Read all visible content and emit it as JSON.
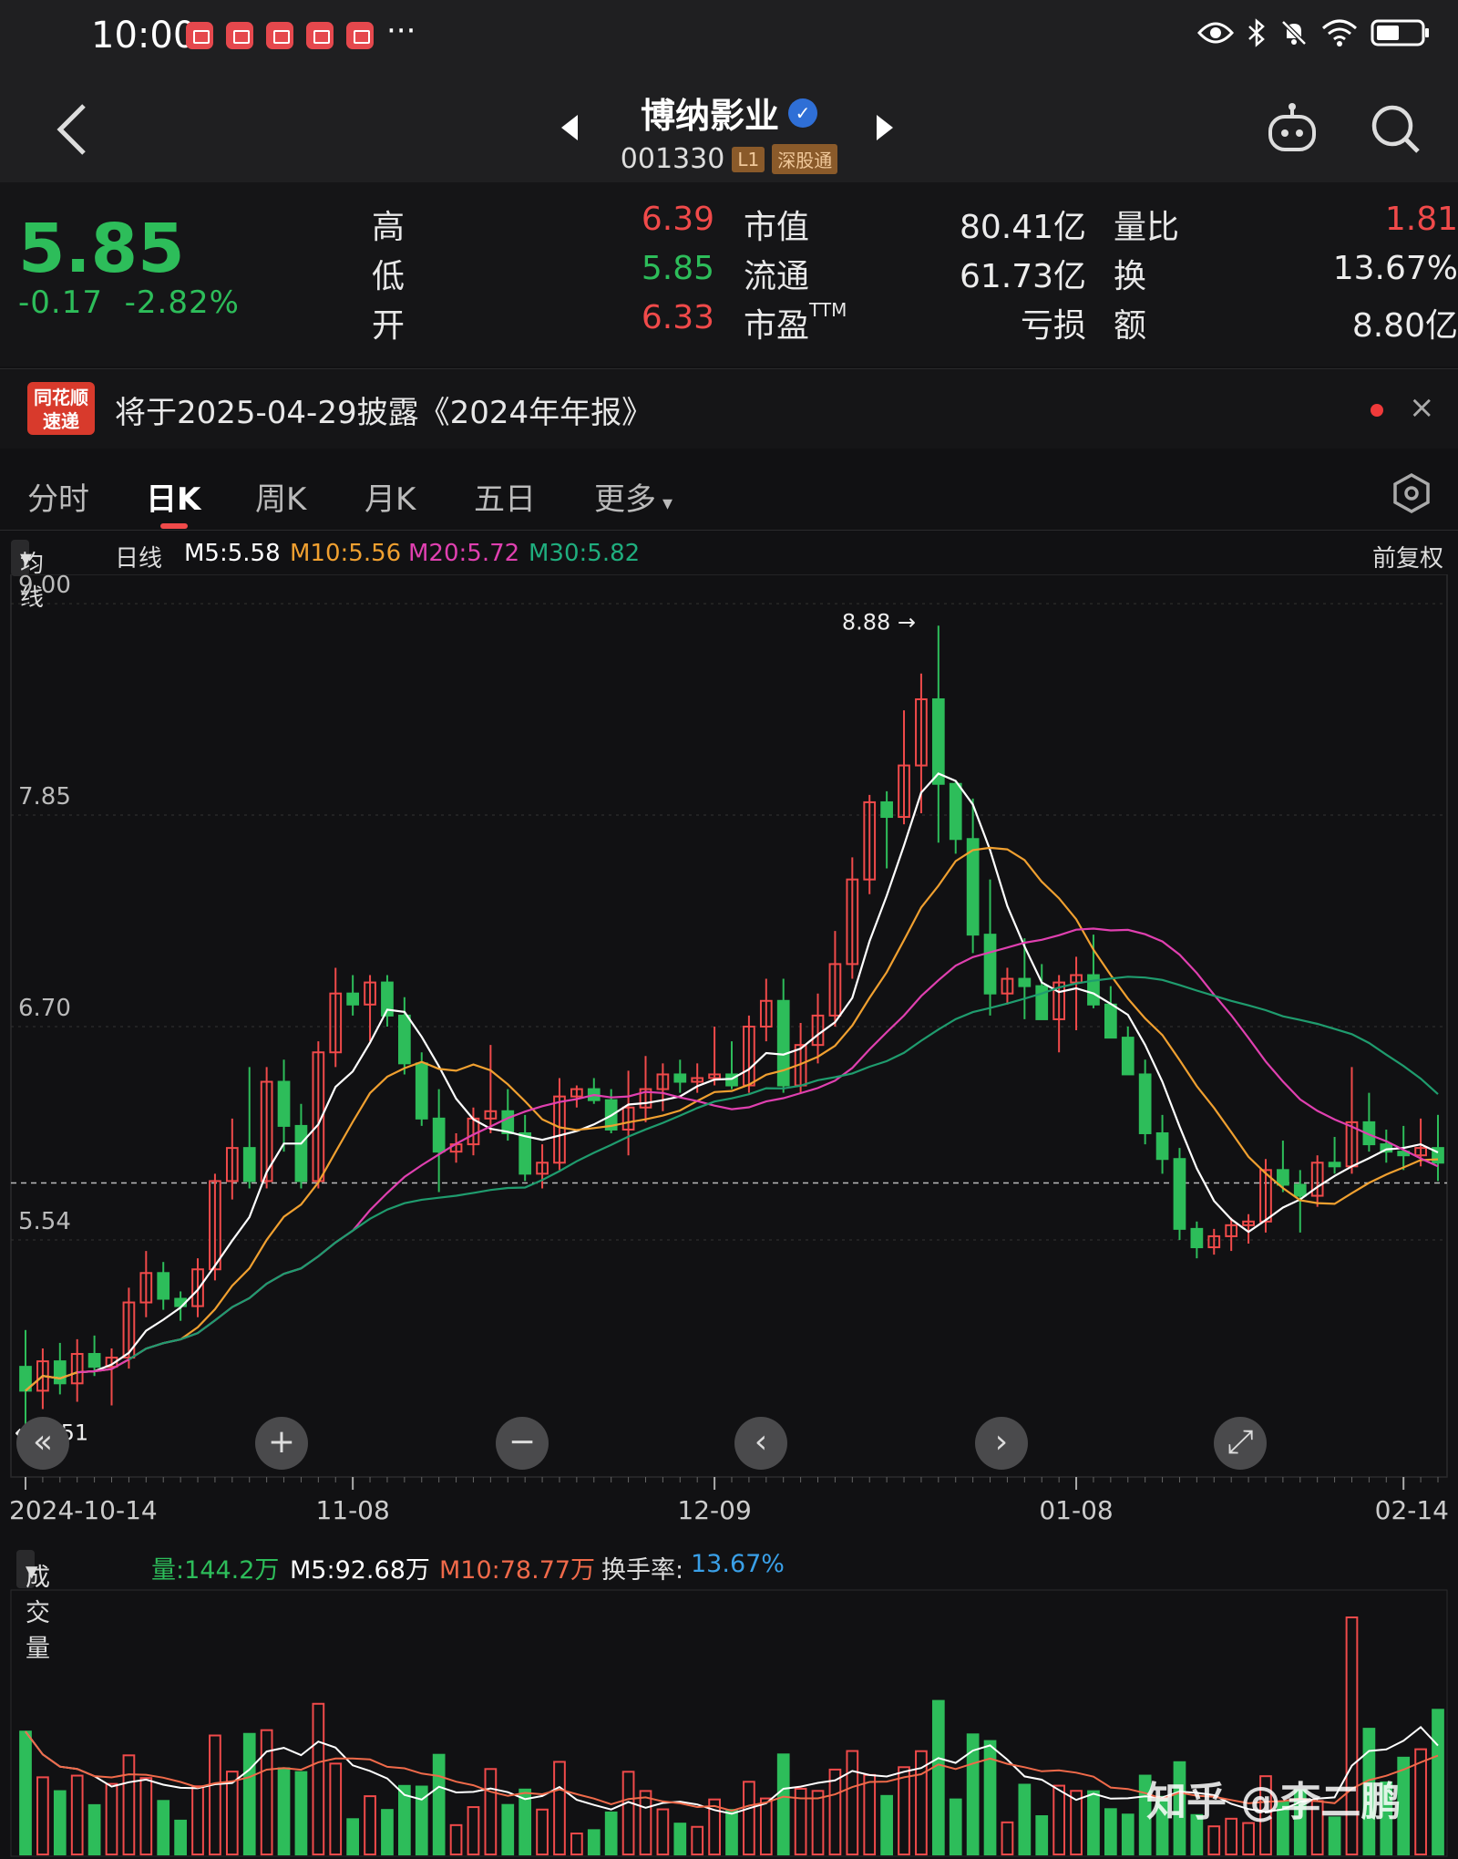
{
  "status_bar": {
    "time": "10:00",
    "overflow": "···"
  },
  "header": {
    "name": "博纳影业",
    "code": "001330",
    "level": "L1",
    "channel": "深股通"
  },
  "quote": {
    "price": "5.85",
    "change": "-0.17",
    "change_pct": "-2.82%",
    "fields": [
      {
        "label": "高",
        "value": "6.39",
        "color": "red"
      },
      {
        "label": "低",
        "value": "5.85",
        "color": "green"
      },
      {
        "label": "开",
        "value": "6.33",
        "color": "red"
      },
      {
        "label": "市值",
        "value": "80.41亿",
        "color": "white"
      },
      {
        "label": "流通",
        "value": "61.73亿",
        "color": "white"
      },
      {
        "label": "市盈",
        "sup": "TTM",
        "value": "亏损",
        "color": "white"
      },
      {
        "label": "量比",
        "value": "1.81",
        "color": "red"
      },
      {
        "label": "换",
        "value": "13.67%",
        "color": "white"
      },
      {
        "label": "额",
        "value": "8.80亿",
        "color": "white"
      }
    ]
  },
  "notice": {
    "logo_top": "同花顺",
    "logo_bottom": "速递",
    "text": "将于2025-04-29披露《2024年年报》",
    "close": "×"
  },
  "tabs": [
    "分时",
    "日K",
    "周K",
    "月K",
    "五日",
    "更多"
  ],
  "ma_legend": {
    "selector": "均线",
    "period": "日线",
    "m5": "M5:5.58",
    "m10": "M10:5.56",
    "m20": "M20:5.72",
    "m30": "M30:5.82",
    "adjust": "前复权"
  },
  "colors": {
    "up": "#f04a4a",
    "down": "#2dbd5a",
    "m5": "#ffffff",
    "m10": "#f0a030",
    "m20": "#e040b0",
    "m30": "#1f9c6e",
    "turnover": "#3aa0e8"
  },
  "chart_data": {
    "type": "candlestick",
    "y_ticks": [
      "9.00",
      "7.85",
      "6.70",
      "5.54"
    ],
    "ylim": [
      4.35,
      9.05
    ],
    "x_labels": [
      "2024-10-14",
      "11-08",
      "12-09",
      "01-08",
      "02-14"
    ],
    "x_label_index": [
      0,
      19,
      40,
      61,
      80
    ],
    "max_label": "8.88",
    "min_label": "4.51",
    "last_close": 5.85,
    "candles": [
      {
        "o": 4.85,
        "h": 5.05,
        "l": 4.51,
        "c": 4.72
      },
      {
        "o": 4.72,
        "h": 4.95,
        "l": 4.62,
        "c": 4.88
      },
      {
        "o": 4.88,
        "h": 4.98,
        "l": 4.7,
        "c": 4.76
      },
      {
        "o": 4.76,
        "h": 5.0,
        "l": 4.66,
        "c": 4.92
      },
      {
        "o": 4.92,
        "h": 5.02,
        "l": 4.8,
        "c": 4.85
      },
      {
        "o": 4.85,
        "h": 4.95,
        "l": 4.64,
        "c": 4.9
      },
      {
        "o": 4.9,
        "h": 5.28,
        "l": 4.84,
        "c": 5.2
      },
      {
        "o": 5.2,
        "h": 5.48,
        "l": 5.12,
        "c": 5.36
      },
      {
        "o": 5.36,
        "h": 5.42,
        "l": 5.16,
        "c": 5.22
      },
      {
        "o": 5.22,
        "h": 5.26,
        "l": 5.1,
        "c": 5.18
      },
      {
        "o": 5.18,
        "h": 5.44,
        "l": 5.12,
        "c": 5.38
      },
      {
        "o": 5.38,
        "h": 5.9,
        "l": 5.32,
        "c": 5.86
      },
      {
        "o": 5.86,
        "h": 6.2,
        "l": 5.76,
        "c": 6.04
      },
      {
        "o": 6.04,
        "h": 6.48,
        "l": 5.82,
        "c": 5.86
      },
      {
        "o": 5.86,
        "h": 6.48,
        "l": 5.82,
        "c": 6.4
      },
      {
        "o": 6.4,
        "h": 6.52,
        "l": 6.02,
        "c": 6.16
      },
      {
        "o": 6.16,
        "h": 6.28,
        "l": 5.82,
        "c": 5.86
      },
      {
        "o": 5.86,
        "h": 6.62,
        "l": 5.82,
        "c": 6.56
      },
      {
        "o": 6.56,
        "h": 7.02,
        "l": 6.48,
        "c": 6.88
      },
      {
        "o": 6.88,
        "h": 6.98,
        "l": 6.76,
        "c": 6.82
      },
      {
        "o": 6.82,
        "h": 6.98,
        "l": 6.62,
        "c": 6.94
      },
      {
        "o": 6.94,
        "h": 6.98,
        "l": 6.7,
        "c": 6.76
      },
      {
        "o": 6.76,
        "h": 6.86,
        "l": 6.44,
        "c": 6.5
      },
      {
        "o": 6.5,
        "h": 6.56,
        "l": 6.16,
        "c": 6.2
      },
      {
        "o": 6.2,
        "h": 6.36,
        "l": 5.8,
        "c": 6.02
      },
      {
        "o": 6.02,
        "h": 6.12,
        "l": 5.96,
        "c": 6.06
      },
      {
        "o": 6.06,
        "h": 6.26,
        "l": 6.0,
        "c": 6.2
      },
      {
        "o": 6.2,
        "h": 6.6,
        "l": 6.12,
        "c": 6.24
      },
      {
        "o": 6.24,
        "h": 6.36,
        "l": 6.08,
        "c": 6.12
      },
      {
        "o": 6.12,
        "h": 6.22,
        "l": 5.86,
        "c": 5.9
      },
      {
        "o": 5.9,
        "h": 6.06,
        "l": 5.82,
        "c": 5.96
      },
      {
        "o": 5.96,
        "h": 6.42,
        "l": 5.92,
        "c": 6.32
      },
      {
        "o": 6.32,
        "h": 6.38,
        "l": 6.26,
        "c": 6.36
      },
      {
        "o": 6.36,
        "h": 6.42,
        "l": 6.28,
        "c": 6.3
      },
      {
        "o": 6.3,
        "h": 6.36,
        "l": 6.12,
        "c": 6.14
      },
      {
        "o": 6.14,
        "h": 6.46,
        "l": 6.0,
        "c": 6.26
      },
      {
        "o": 6.26,
        "h": 6.54,
        "l": 6.18,
        "c": 6.36
      },
      {
        "o": 6.36,
        "h": 6.5,
        "l": 6.24,
        "c": 6.44
      },
      {
        "o": 6.44,
        "h": 6.52,
        "l": 6.34,
        "c": 6.4
      },
      {
        "o": 6.4,
        "h": 6.5,
        "l": 6.34,
        "c": 6.42
      },
      {
        "o": 6.42,
        "h": 6.7,
        "l": 6.38,
        "c": 6.44
      },
      {
        "o": 6.44,
        "h": 6.62,
        "l": 6.36,
        "c": 6.38
      },
      {
        "o": 6.38,
        "h": 6.76,
        "l": 6.34,
        "c": 6.7
      },
      {
        "o": 6.7,
        "h": 6.96,
        "l": 6.62,
        "c": 6.84
      },
      {
        "o": 6.84,
        "h": 6.96,
        "l": 6.34,
        "c": 6.38
      },
      {
        "o": 6.38,
        "h": 6.72,
        "l": 6.34,
        "c": 6.6
      },
      {
        "o": 6.6,
        "h": 6.88,
        "l": 6.5,
        "c": 6.76
      },
      {
        "o": 6.76,
        "h": 7.22,
        "l": 6.7,
        "c": 7.04
      },
      {
        "o": 7.04,
        "h": 7.62,
        "l": 6.96,
        "c": 7.5
      },
      {
        "o": 7.5,
        "h": 7.96,
        "l": 7.42,
        "c": 7.92
      },
      {
        "o": 7.92,
        "h": 7.98,
        "l": 7.56,
        "c": 7.84
      },
      {
        "o": 7.84,
        "h": 8.42,
        "l": 7.8,
        "c": 8.12
      },
      {
        "o": 8.12,
        "h": 8.62,
        "l": 7.86,
        "c": 8.48
      },
      {
        "o": 8.48,
        "h": 8.88,
        "l": 7.7,
        "c": 8.02
      },
      {
        "o": 8.02,
        "h": 8.04,
        "l": 7.64,
        "c": 7.72
      },
      {
        "o": 7.72,
        "h": 7.94,
        "l": 7.1,
        "c": 7.2
      },
      {
        "o": 7.2,
        "h": 7.5,
        "l": 6.76,
        "c": 6.88
      },
      {
        "o": 6.88,
        "h": 7.02,
        "l": 6.82,
        "c": 6.96
      },
      {
        "o": 6.96,
        "h": 7.18,
        "l": 6.74,
        "c": 6.92
      },
      {
        "o": 6.92,
        "h": 7.04,
        "l": 6.8,
        "c": 6.74
      },
      {
        "o": 6.74,
        "h": 6.98,
        "l": 6.56,
        "c": 6.94
      },
      {
        "o": 6.94,
        "h": 7.08,
        "l": 6.68,
        "c": 6.98
      },
      {
        "o": 6.98,
        "h": 7.2,
        "l": 6.8,
        "c": 6.82
      },
      {
        "o": 6.82,
        "h": 6.92,
        "l": 6.64,
        "c": 6.64
      },
      {
        "o": 6.64,
        "h": 6.7,
        "l": 6.46,
        "c": 6.44
      },
      {
        "o": 6.44,
        "h": 6.52,
        "l": 6.06,
        "c": 6.12
      },
      {
        "o": 6.12,
        "h": 6.22,
        "l": 5.9,
        "c": 5.98
      },
      {
        "o": 5.98,
        "h": 6.04,
        "l": 5.54,
        "c": 5.6
      },
      {
        "o": 5.6,
        "h": 5.64,
        "l": 5.44,
        "c": 5.5
      },
      {
        "o": 5.5,
        "h": 5.6,
        "l": 5.46,
        "c": 5.56
      },
      {
        "o": 5.56,
        "h": 5.66,
        "l": 5.48,
        "c": 5.62
      },
      {
        "o": 5.62,
        "h": 5.68,
        "l": 5.52,
        "c": 5.64
      },
      {
        "o": 5.64,
        "h": 5.98,
        "l": 5.58,
        "c": 5.92
      },
      {
        "o": 5.92,
        "h": 6.08,
        "l": 5.8,
        "c": 5.84
      },
      {
        "o": 5.84,
        "h": 5.92,
        "l": 5.58,
        "c": 5.78
      },
      {
        "o": 5.78,
        "h": 6.0,
        "l": 5.72,
        "c": 5.96
      },
      {
        "o": 5.96,
        "h": 6.1,
        "l": 5.9,
        "c": 5.94
      },
      {
        "o": 5.94,
        "h": 6.48,
        "l": 5.9,
        "c": 6.18
      },
      {
        "o": 6.18,
        "h": 6.34,
        "l": 6.02,
        "c": 6.06
      },
      {
        "o": 6.06,
        "h": 6.14,
        "l": 5.96,
        "c": 6.02
      },
      {
        "o": 6.02,
        "h": 6.16,
        "l": 5.92,
        "c": 6.0
      },
      {
        "o": 6.0,
        "h": 6.2,
        "l": 5.94,
        "c": 6.04
      },
      {
        "o": 6.04,
        "h": 6.22,
        "l": 5.86,
        "c": 5.96
      }
    ],
    "volume": {
      "label": "成交量",
      "vol": "量:144.2万",
      "m5": "M5:92.68万",
      "m10": "M10:78.77万",
      "turnover_label": "换手率:",
      "turnover": "13.67%"
    }
  },
  "nav_buttons": [
    "«",
    "+",
    "−",
    "‹",
    "›",
    "⤢"
  ],
  "watermark": "知乎 @李二鹏"
}
